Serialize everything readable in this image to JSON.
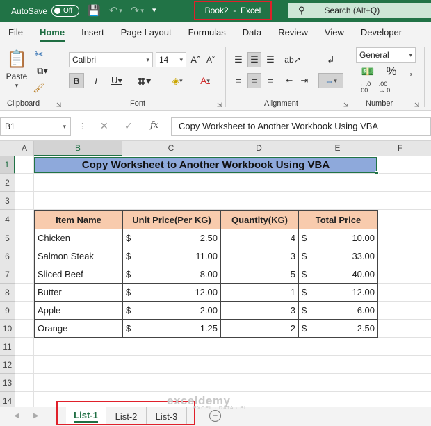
{
  "titlebar": {
    "autosave_label": "AutoSave",
    "autosave_state": "Off",
    "document_title": "Book2  -  Excel",
    "search_placeholder": "Search (Alt+Q)"
  },
  "menu": [
    "File",
    "Home",
    "Insert",
    "Page Layout",
    "Formulas",
    "Data",
    "Review",
    "View",
    "Developer"
  ],
  "ribbon": {
    "paste_label": "Paste",
    "font_name": "Calibri",
    "font_size": "14",
    "number_format": "General",
    "group_labels": {
      "clipboard": "Clipboard",
      "font": "Font",
      "alignment": "Alignment",
      "number": "Number"
    },
    "accent_color": "#217346"
  },
  "formula_bar": {
    "name_box": "B1",
    "fx": "fx",
    "content": "Copy Worksheet to Another Workbook Using VBA"
  },
  "columns": [
    "A",
    "B",
    "C",
    "D",
    "E",
    "F"
  ],
  "rows": [
    "1",
    "2",
    "3",
    "4",
    "5",
    "6",
    "7",
    "8",
    "9",
    "10",
    "11",
    "12",
    "13",
    "14"
  ],
  "sheet": {
    "title": "Copy Worksheet to Another Workbook Using VBA",
    "headers": [
      "Item Name",
      "Unit Price(Per KG)",
      "Quantity(KG)",
      "Total Price"
    ],
    "currency": "$",
    "items": [
      {
        "name": "Chicken",
        "unit_price": "2.50",
        "quantity": "4",
        "total": "10.00"
      },
      {
        "name": "Salmon Steak",
        "unit_price": "11.00",
        "quantity": "3",
        "total": "33.00"
      },
      {
        "name": "Sliced Beef",
        "unit_price": "8.00",
        "quantity": "5",
        "total": "40.00"
      },
      {
        "name": "Butter",
        "unit_price": "12.00",
        "quantity": "1",
        "total": "12.00"
      },
      {
        "name": "Apple",
        "unit_price": "2.00",
        "quantity": "3",
        "total": "6.00"
      },
      {
        "name": "Orange",
        "unit_price": "1.25",
        "quantity": "2",
        "total": "2.50"
      }
    ]
  },
  "sheet_tabs": [
    "List-1",
    "List-2",
    "List-3"
  ],
  "watermark": {
    "brand": "exceldemy",
    "tagline": "EXCEL · DATA · BI"
  }
}
